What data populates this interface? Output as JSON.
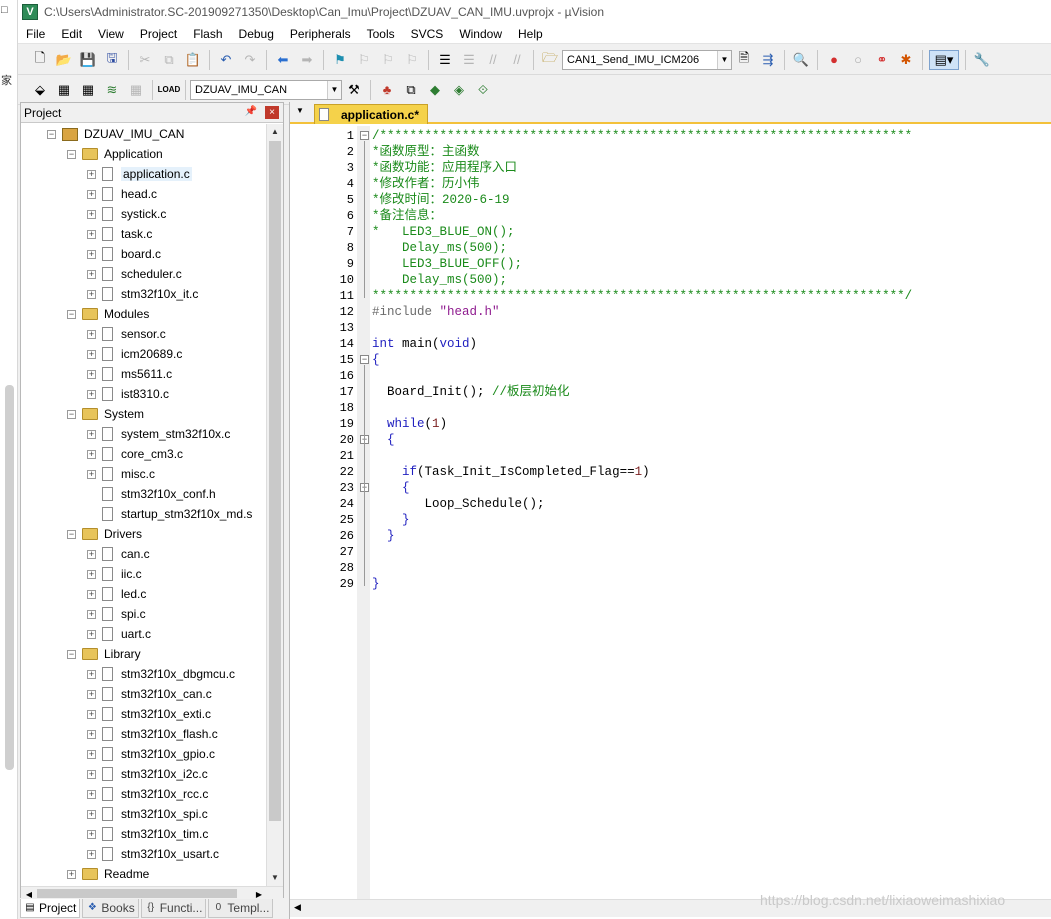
{
  "window": {
    "title": "C:\\Users\\Administrator.SC-201909271350\\Desktop\\Can_Imu\\Project\\DZUAV_CAN_IMU.uvprojx - µVision"
  },
  "menu": [
    "File",
    "Edit",
    "View",
    "Project",
    "Flash",
    "Debug",
    "Peripherals",
    "Tools",
    "SVCS",
    "Window",
    "Help"
  ],
  "toolbar1": {
    "target_combo": "CAN1_Send_IMU_ICM206"
  },
  "toolbar2": {
    "target_select": "DZUAV_IMU_CAN"
  },
  "leftstrip": {
    "chars": [
      "□",
      "家"
    ]
  },
  "project_panel": {
    "title": "Project",
    "root": "DZUAV_IMU_CAN",
    "groups": [
      {
        "name": "Application",
        "files": [
          "application.c",
          "head.c",
          "systick.c",
          "task.c",
          "board.c",
          "scheduler.c",
          "stm32f10x_it.c"
        ]
      },
      {
        "name": "Modules",
        "files": [
          "sensor.c",
          "icm20689.c",
          "ms5611.c",
          "ist8310.c"
        ]
      },
      {
        "name": "System",
        "files": [
          "system_stm32f10x.c",
          "core_cm3.c",
          "misc.c",
          "stm32f10x_conf.h",
          "startup_stm32f10x_md.s"
        ]
      },
      {
        "name": "Drivers",
        "files": [
          "can.c",
          "iic.c",
          "led.c",
          "spi.c",
          "uart.c"
        ]
      },
      {
        "name": "Library",
        "files": [
          "stm32f10x_dbgmcu.c",
          "stm32f10x_can.c",
          "stm32f10x_exti.c",
          "stm32f10x_flash.c",
          "stm32f10x_gpio.c",
          "stm32f10x_i2c.c",
          "stm32f10x_rcc.c",
          "stm32f10x_spi.c",
          "stm32f10x_tim.c",
          "stm32f10x_usart.c"
        ]
      },
      {
        "name": "Readme",
        "files": []
      }
    ],
    "selected_file": "application.c"
  },
  "bottom_tabs": [
    "Project",
    "Books",
    "Functi...",
    "Templ..."
  ],
  "editor": {
    "tab_label": "application.c*",
    "lines": [
      "/***********************************************************************",
      "*函数原型：主函数",
      "*函数功能：应用程序入口",
      "*修改作者：历小伟",
      "*修改时间：2020-6-19",
      "*备注信息：",
      "*   LED3_BLUE_ON();",
      "    Delay_ms(500);",
      "    LED3_BLUE_OFF();",
      "    Delay_ms(500);",
      "***********************************************************************/",
      "#include \"head.h\"",
      "",
      "int main(void)",
      "{",
      "",
      "  Board_Init(); //板层初始化",
      "",
      "  while(1)",
      "  {",
      "",
      "    if(Task_Init_IsCompleted_Flag==1)",
      "    {",
      "       Loop_Schedule();",
      "    }",
      "  }",
      "",
      "",
      "}"
    ]
  },
  "watermark": "https://blog.csdn.net/lixiaoweimashixiao"
}
